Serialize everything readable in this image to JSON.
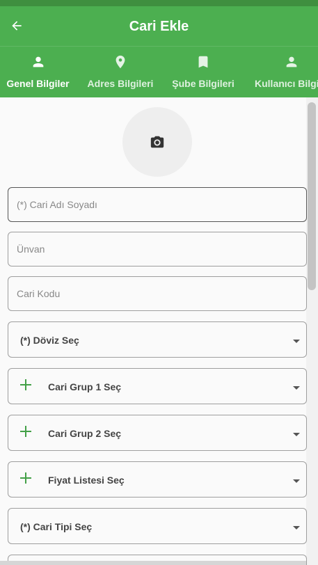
{
  "app_bar": {
    "title": "Cari Ekle",
    "back_icon": "arrow-left-icon",
    "color": "#4caf50"
  },
  "tabs": [
    {
      "label": "Genel Bilgiler",
      "icon": "person-icon",
      "active": true
    },
    {
      "label": "Adres Bilgileri",
      "icon": "location-pin-icon",
      "active": false
    },
    {
      "label": "Şube Bilgileri",
      "icon": "bookmark-icon",
      "active": false
    },
    {
      "label": "Kullanıcı Bilgileri",
      "icon": "person-icon",
      "active": false
    }
  ],
  "avatar": {
    "icon": "camera-icon"
  },
  "form": {
    "cari_adi": {
      "placeholder": "(*) Cari Adı Soyadı",
      "value": ""
    },
    "unvan": {
      "placeholder": "Ünvan",
      "value": ""
    },
    "cari_kodu": {
      "placeholder": "Cari Kodu",
      "value": ""
    }
  },
  "dropdowns": [
    {
      "label": "(*) Döviz Seç",
      "has_add": false
    },
    {
      "label": "Cari Grup 1 Seç",
      "has_add": true
    },
    {
      "label": "Cari Grup 2 Seç",
      "has_add": true
    },
    {
      "label": "Fiyat Listesi Seç",
      "has_add": true
    },
    {
      "label": "(*) Cari Tipi Seç",
      "has_add": false
    }
  ],
  "colors": {
    "accent": "#4caf50",
    "plus": "#43a047"
  }
}
